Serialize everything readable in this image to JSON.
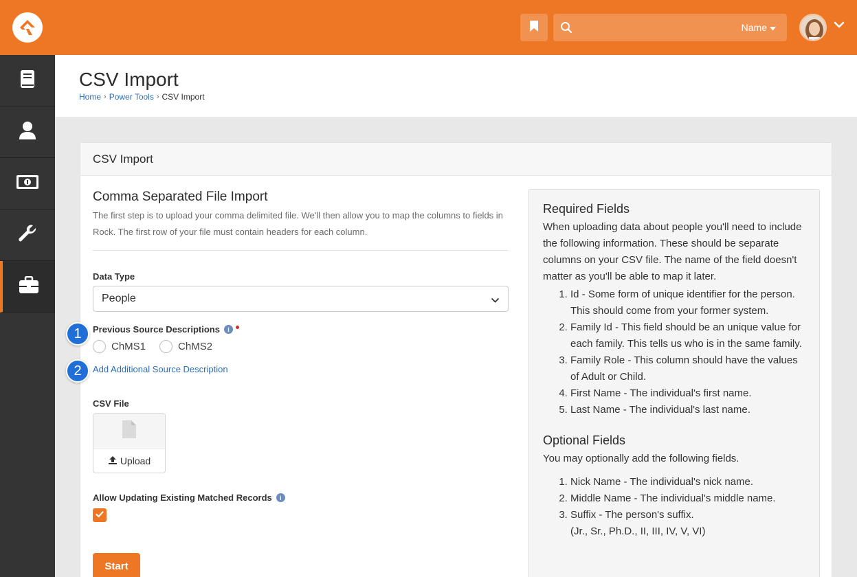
{
  "topbar": {
    "search_placeholder": "",
    "search_filter_label": "Name",
    "brand_color": "#ee7725"
  },
  "sidebar": {
    "items": [
      {
        "icon": "book-icon"
      },
      {
        "icon": "person-icon"
      },
      {
        "icon": "money-icon"
      },
      {
        "icon": "wrench-icon"
      },
      {
        "icon": "briefcase-icon",
        "active": true
      }
    ]
  },
  "page": {
    "title": "CSV Import",
    "breadcrumb": [
      "Home",
      "Power Tools",
      "CSV Import"
    ]
  },
  "panel": {
    "heading": "CSV Import",
    "form_title": "Comma Separated File Import",
    "form_desc": "The first step is to upload your comma delimited file. We'll then allow you to map the columns to fields in Rock. The first row of your file must contain headers for each column.",
    "data_type_label": "Data Type",
    "data_type_value": "People",
    "prev_src_label": "Previous Source Descriptions",
    "radio_options": [
      "ChMS1",
      "ChMS2"
    ],
    "add_source_link": "Add Additional Source Description",
    "csv_file_label": "CSV File",
    "upload_label": "Upload",
    "allow_update_label": "Allow Updating Existing Matched Records",
    "allow_update_checked": true,
    "start_button": "Start"
  },
  "info": {
    "required_title": "Required Fields",
    "required_intro": "When uploading data about people you'll need to include the following information. These should be separate columns on your CSV file. The name of the field doesn't matter as you'll be able to map it later.",
    "required_items": [
      "Id - Some form of unique identifier for the person. This should come from your former system.",
      "Family Id - This field should be an unique value for each family. This tells us who is in the same family.",
      "Family Role - This column should have the values of Adult or Child.",
      "First Name - The individual's first name.",
      "Last Name - The individual's last name."
    ],
    "optional_title": "Optional Fields",
    "optional_intro": "You may optionally add the following fields.",
    "optional_items": [
      "Nick Name - The individual's nick name.",
      "Middle Name - The individual's middle name.",
      "Suffix - The person's suffix."
    ],
    "suffix_note": "(Jr., Sr., Ph.D., II, III, IV, V, VI)"
  },
  "badges": [
    "1",
    "2"
  ]
}
